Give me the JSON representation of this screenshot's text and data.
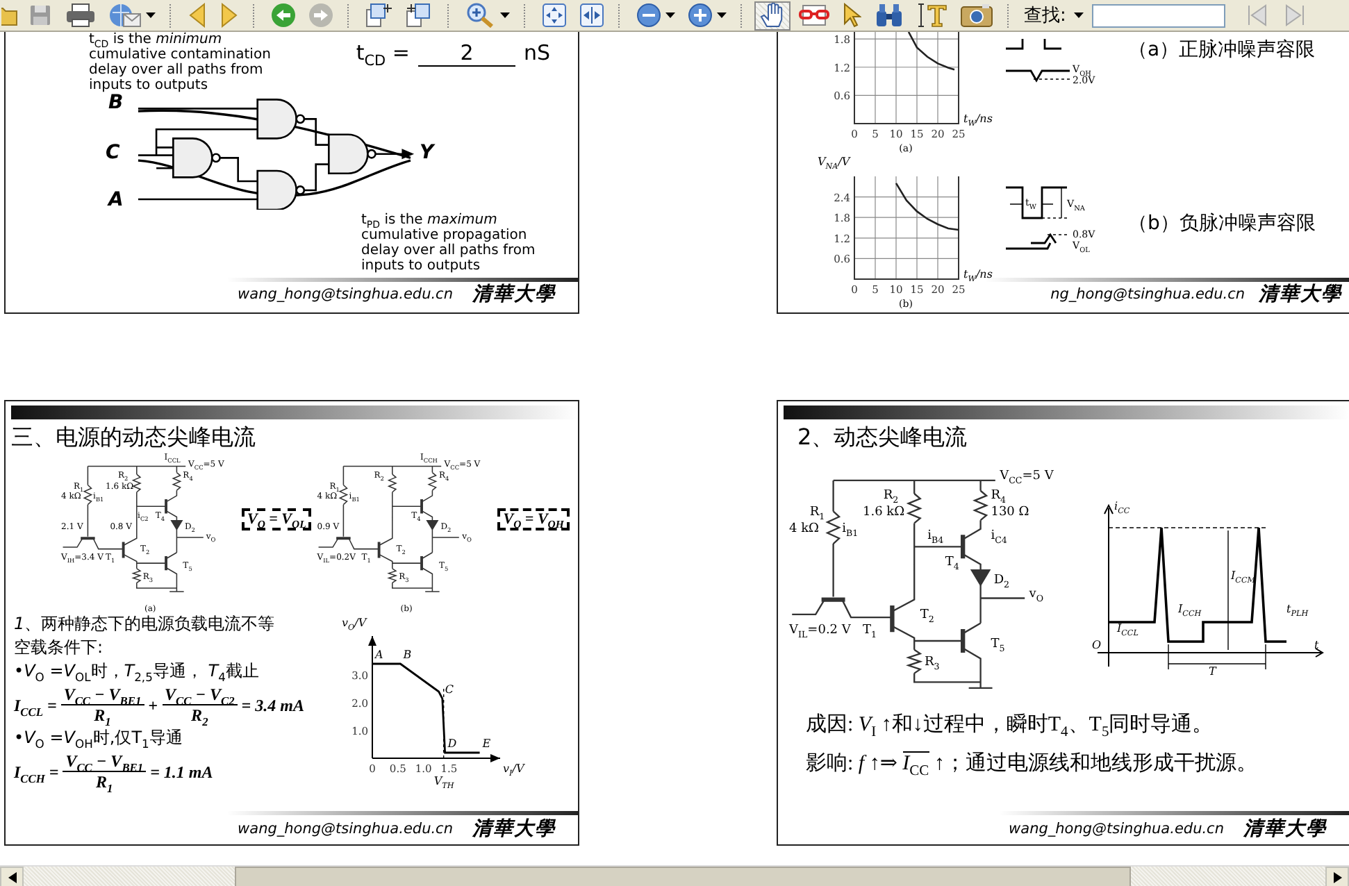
{
  "toolbar": {
    "hand_tool_selected": true,
    "search_label": "查找:"
  },
  "slide_gates": {
    "cd_note": "t$_{CD}$ is the *minimum* cumulative contamination delay over all paths from inputs to outputs",
    "cd_label": "t$_{CD}$ =",
    "cd_value": "2",
    "cd_unit": "nS",
    "gate_labels": [
      "B",
      "C",
      "A",
      "Y"
    ],
    "pd_note": "t$_{PD}$ is the *maximum* cumulative propagation delay over all paths from inputs to outputs",
    "footer": "wang_hong@tsinghua.edu.cn",
    "logo": "清華大學"
  },
  "slide_noise": {
    "panels": [
      {
        "kind": "positive",
        "chart_data": {
          "type": "line",
          "xlabel": "t$_{W}$/ns",
          "x": [
            13,
            15,
            17.5,
            20,
            22.5,
            24
          ],
          "values": [
            1.95,
            1.62,
            1.42,
            1.28,
            1.19,
            1.15
          ],
          "xlim": [
            0,
            25
          ],
          "ylim": [
            0,
            1.95
          ],
          "xticks": [
            0,
            5,
            10,
            15,
            20,
            25
          ],
          "yticks": [
            0.6,
            1.2,
            1.8
          ],
          "grid": true
        },
        "caption": "(a)",
        "pulse_labels": [
          "V$_{OH}$",
          "2.0V"
        ],
        "heading": "（a）正脉冲噪声容限"
      },
      {
        "kind": "negative",
        "chart_data": {
          "type": "line",
          "xlabel": "t$_{W}$/ns",
          "ylabel": "V$_{NA}$/V",
          "x": [
            10,
            12.5,
            15,
            17.5,
            20,
            22.5,
            25
          ],
          "values": [
            2.8,
            2.3,
            1.98,
            1.76,
            1.6,
            1.48,
            1.44
          ],
          "xlim": [
            0,
            25
          ],
          "ylim": [
            0,
            3.0
          ],
          "xticks": [
            0,
            5,
            10,
            15,
            20,
            25
          ],
          "yticks": [
            0.6,
            1.2,
            1.8,
            2.4
          ],
          "grid": true
        },
        "caption": "(b)",
        "pulse_labels": [
          "t$_{W}$",
          "V$_{NA}$",
          "0.8V",
          "V$_{OL}$"
        ],
        "heading": "（b）负脉冲噪声容限"
      }
    ],
    "footer": "ng_hong@tsinghua.edu.cn",
    "logo": "清華大學"
  },
  "slide_supply": {
    "title": "三、电源的动态尖峰电流",
    "circuits": [
      {
        "caption": "(a)",
        "state_box": "V$_{O}$ = V$_{OL}$",
        "labels": [
          {
            "kind": "supply_current",
            "text": "I$_{CCL}$"
          },
          {
            "kind": "vcc",
            "text": "V$_{CC}$=5 V"
          },
          {
            "kind": "r2_name",
            "text": "R$_{2}$"
          },
          {
            "kind": "r4_name",
            "text": "R$_{4}$"
          },
          {
            "kind": "r1_name",
            "text": "R$_{1}$"
          },
          {
            "kind": "r2_value",
            "text": "1.6 kΩ"
          },
          {
            "kind": "r1_value",
            "text": "4 kΩ"
          },
          {
            "kind": "ib1",
            "text": "i$_{B1}$"
          },
          {
            "kind": "ic2",
            "text": "i$_{C2}$"
          },
          {
            "kind": "t4",
            "text": "T$_{4}$"
          },
          {
            "kind": "t1_base",
            "text": "2.1 V"
          },
          {
            "kind": "t2_base",
            "text": "0.8 V"
          },
          {
            "kind": "d2",
            "text": "D$_{2}$"
          },
          {
            "kind": "vo",
            "text": "v$_{O}$"
          },
          {
            "kind": "t2",
            "text": "T$_{2}$"
          },
          {
            "kind": "vin",
            "text": "V$_{IH}$=3.4 V"
          },
          {
            "kind": "t1",
            "text": "T$_{1}$"
          },
          {
            "kind": "t5",
            "text": "T$_{5}$"
          },
          {
            "kind": "r3",
            "text": "R$_{3}$"
          }
        ]
      },
      {
        "caption": "(b)",
        "state_box": "V$_{O}$ = V$_{OH}$",
        "labels": [
          {
            "kind": "supply_current",
            "text": "I$_{CCH}$"
          },
          {
            "kind": "vcc",
            "text": "V$_{CC}$=5 V"
          },
          {
            "kind": "r2_name",
            "text": "R$_{2}$"
          },
          {
            "kind": "r4_name",
            "text": "R$_{4}$"
          },
          {
            "kind": "r1_name",
            "text": "R$_{1}$"
          },
          {
            "kind": "r1_value",
            "text": "4 kΩ"
          },
          {
            "kind": "ib1",
            "text": "i$_{B1}$"
          },
          {
            "kind": "t4",
            "text": "T$_{4}$"
          },
          {
            "kind": "t1_base",
            "text": "0.9 V"
          },
          {
            "kind": "d2",
            "text": "D$_{2}$"
          },
          {
            "kind": "vo",
            "text": "v$_{O}$"
          },
          {
            "kind": "t2",
            "text": "T$_{2}$"
          },
          {
            "kind": "vin",
            "text": "V$_{IL}$=0.2V"
          },
          {
            "kind": "t1",
            "text": "T$_{1}$"
          },
          {
            "kind": "t5",
            "text": "T$_{5}$"
          },
          {
            "kind": "r3",
            "text": "R$_{3}$"
          }
        ]
      }
    ],
    "lines": [
      {
        "kind": "text",
        "text": "*1*、两种静态下的电源负载电流不等"
      },
      {
        "kind": "text",
        "text": "空载条件下:"
      },
      {
        "kind": "text",
        "text": "•*V*$_{O}$ =*V*$_{OL}$时，*T*$_{2,5}$导通， *T*$_{4}$截止"
      },
      {
        "kind": "formula",
        "parts": [
          {
            "kind": "text",
            "text": "I$_{CCL}$ ="
          },
          {
            "kind": "frac",
            "num": "V$_{CC}$ − V$_{BE1}$",
            "den": "R$_{1}$"
          },
          {
            "kind": "text",
            "text": "+"
          },
          {
            "kind": "frac",
            "num": "V$_{CC}$ − V$_{C2}$",
            "den": "R$_{2}$"
          },
          {
            "kind": "text",
            "text": "= 3.4 mA"
          }
        ]
      },
      {
        "kind": "text",
        "text": "•*V*$_{O}$ =*V*$_{OH}$时,仅T$_{1}$导通"
      },
      {
        "kind": "formula",
        "parts": [
          {
            "kind": "text",
            "text": "I$_{CCH}$ ="
          },
          {
            "kind": "frac",
            "num": "V$_{CC}$ − V$_{BE1}$",
            "den": "R$_{1}$"
          },
          {
            "kind": "text",
            "text": "= 1.1 mA"
          }
        ]
      }
    ],
    "chart_data": {
      "type": "line",
      "xlabel": "v$_{I}$/V",
      "ylabel": "v$_{O}$/V",
      "x": [
        0,
        0.55,
        1.3,
        1.37,
        1.42,
        2.1
      ],
      "values": [
        3.4,
        3.4,
        2.4,
        2.15,
        0.2,
        0.2
      ],
      "xlim": [
        0,
        2.5
      ],
      "ylim": [
        0,
        4.4
      ],
      "xticks": [
        0,
        0.5,
        {
          "value": 1,
          "label": "1.0"
        },
        1.5
      ],
      "yticks": [
        {
          "value": 1,
          "label": "1.0"
        },
        {
          "value": 2,
          "label": "2.0"
        },
        {
          "value": 3,
          "label": "3.0"
        }
      ],
      "annotations": [
        {
          "text": "A",
          "x": 0,
          "y": 3.4
        },
        {
          "text": "B",
          "x": 0.55,
          "y": 3.4
        },
        {
          "text": "C",
          "x": 1.37,
          "y": 2.15
        },
        {
          "text": "D",
          "x": 1.42,
          "y": 0.2
        },
        {
          "text": "E",
          "x": 2.1,
          "y": 0.2
        },
        "V$_{TH}$"
      ]
    },
    "footer": "wang_hong@tsinghua.edu.cn",
    "logo": "清華大學"
  },
  "slide_spike": {
    "title": "2、动态尖峰电流",
    "circuit": {
      "labels": [
        {
          "kind": "vcc",
          "text": "V$_{CC}$=5 V"
        },
        {
          "kind": "r2_name",
          "text": "R$_{2}$"
        },
        {
          "kind": "r4_name",
          "text": "R$_{4}$"
        },
        {
          "kind": "r1_name",
          "text": "R$_{1}$"
        },
        {
          "kind": "r2_value",
          "text": "1.6 kΩ"
        },
        {
          "kind": "r4_value",
          "text": "130 Ω"
        },
        {
          "kind": "r1_value",
          "text": "4 kΩ"
        },
        {
          "kind": "ib1",
          "text": "i$_{B1}$"
        },
        {
          "kind": "ib4",
          "text": "i$_{B4}$"
        },
        {
          "kind": "ic4",
          "text": "i$_{C4}$"
        },
        {
          "kind": "t4",
          "text": "T$_{4}$"
        },
        {
          "kind": "d2",
          "text": "D$_{2}$"
        },
        {
          "kind": "vo",
          "text": "v$_{O}$"
        },
        {
          "kind": "t2",
          "text": "T$_{2}$"
        },
        {
          "kind": "vin",
          "text": "V$_{IL}$=0.2 V"
        },
        {
          "kind": "t1",
          "text": "T$_{1}$"
        },
        {
          "kind": "t5",
          "text": "T$_{5}$"
        },
        {
          "kind": "r3",
          "text": "R$_{3}$"
        }
      ]
    },
    "waveform_labels": [
      {
        "kind": "axis_y",
        "text": "i$_{CC}$"
      },
      {
        "kind": "peak",
        "text": "I$_{CCM}$"
      },
      {
        "kind": "high",
        "text": "I$_{CCH}$"
      },
      {
        "kind": "tplh",
        "text": "t$_{PLH}$"
      },
      {
        "kind": "low",
        "text": "I$_{CCL}$"
      },
      {
        "kind": "origin",
        "text": "O"
      },
      {
        "kind": "axis_x",
        "text": "t"
      },
      {
        "kind": "period",
        "text": "T"
      }
    ],
    "lines": [
      {
        "lead": "成因:  *V*$_{I}$ ↑和↓过程中，瞬时T$_{4}$、T$_{5}$同时导通。"
      },
      {
        "lead": "影响:  *f* ↑⇒ ",
        "overlined": "*I*$_{CC}$",
        "tail": " ↑；通过电源线和地线形成干扰源。"
      }
    ],
    "footer": "wang_hong@tsinghua.edu.cn",
    "logo": "清華大學"
  }
}
